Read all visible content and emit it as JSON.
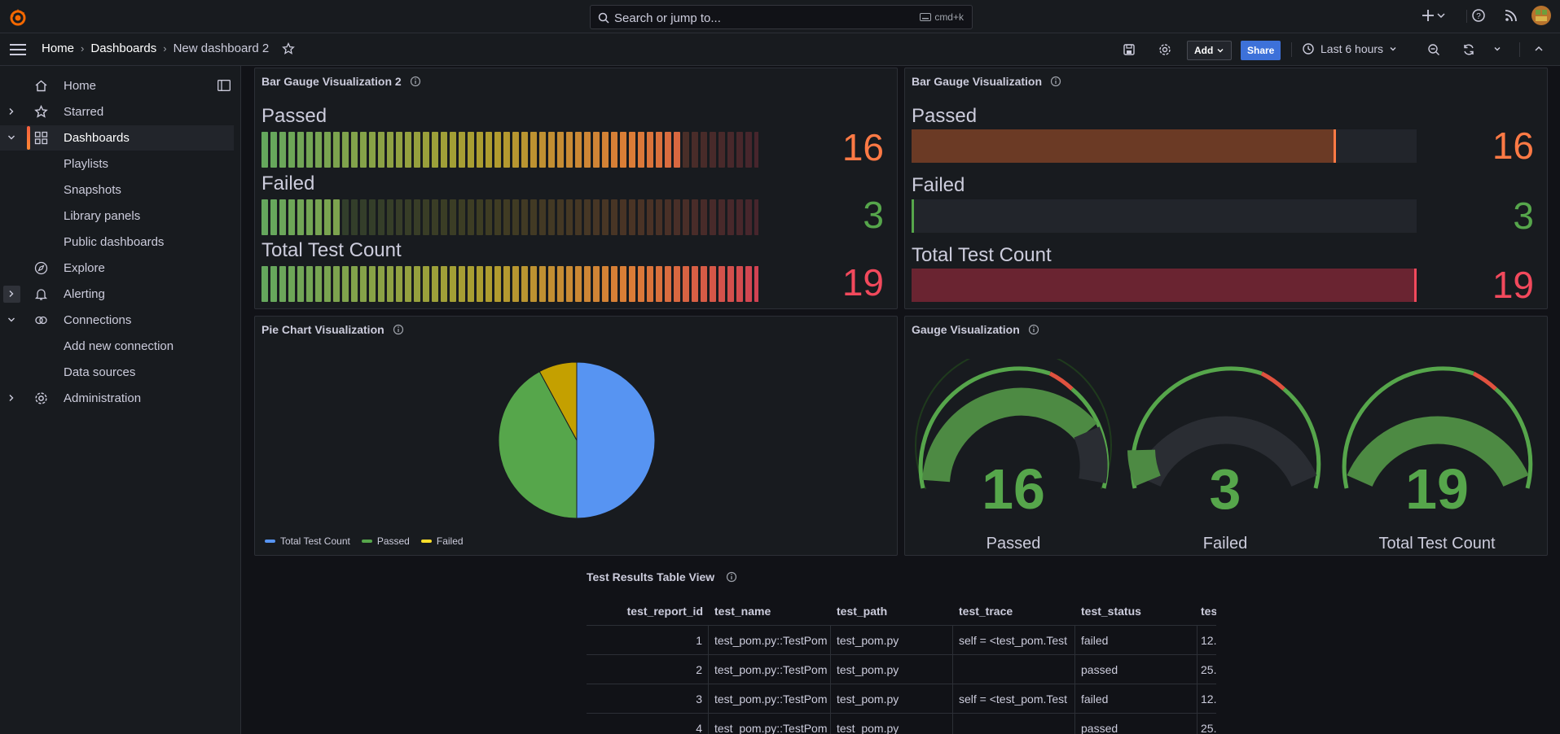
{
  "topbar": {
    "search_placeholder": "Search or jump to...",
    "shortcut": "cmd+k"
  },
  "breadcrumb": [
    "Home",
    "Dashboards",
    "New dashboard 2"
  ],
  "toolbar": {
    "add_label": "Add",
    "share_label": "Share",
    "time_range": "Last 6 hours"
  },
  "sidebar": {
    "items": [
      {
        "label": "Home"
      },
      {
        "label": "Starred"
      },
      {
        "label": "Dashboards"
      },
      {
        "label": "Playlists"
      },
      {
        "label": "Snapshots"
      },
      {
        "label": "Library panels"
      },
      {
        "label": "Public dashboards"
      },
      {
        "label": "Explore"
      },
      {
        "label": "Alerting"
      },
      {
        "label": "Connections"
      },
      {
        "label": "Add new connection"
      },
      {
        "label": "Data sources"
      },
      {
        "label": "Administration"
      }
    ]
  },
  "panels": {
    "bar_gauge_2": {
      "title": "Bar Gauge Visualization 2",
      "rows": [
        {
          "label": "Passed",
          "value": "16",
          "fraction": 0.84
        },
        {
          "label": "Failed",
          "value": "3",
          "fraction": 0.16
        },
        {
          "label": "Total Test Count",
          "value": "19",
          "fraction": 1.0
        }
      ]
    },
    "bar_gauge": {
      "title": "Bar Gauge Visualization",
      "rows": [
        {
          "label": "Passed",
          "value": "16",
          "fraction": 0.84
        },
        {
          "label": "Failed",
          "value": "3",
          "fraction": 0.0
        },
        {
          "label": "Total Test Count",
          "value": "19",
          "fraction": 1.0
        }
      ]
    },
    "pie": {
      "title": "Pie Chart Visualization",
      "legend": [
        "Total Test Count",
        "Passed",
        "Failed"
      ]
    },
    "gauge": {
      "title": "Gauge Visualization",
      "items": [
        {
          "label": "Passed",
          "value": "16"
        },
        {
          "label": "Failed",
          "value": "3"
        },
        {
          "label": "Total Test Count",
          "value": "19"
        }
      ]
    },
    "table": {
      "title": "Test Results Table View",
      "columns": [
        "test_report_id",
        "test_name",
        "test_path",
        "test_trace",
        "test_status",
        "tes"
      ],
      "rows": [
        [
          "1",
          "test_pom.py::TestPom",
          "test_pom.py",
          "self = <test_pom.Test",
          "failed",
          "12."
        ],
        [
          "2",
          "test_pom.py::TestPom",
          "test_pom.py",
          "",
          "passed",
          "25."
        ],
        [
          "3",
          "test_pom.py::TestPom",
          "test_pom.py",
          "self = <test_pom.Test",
          "failed",
          "12."
        ],
        [
          "4",
          "test_pom.py::TestPom",
          "test_pom.py",
          "",
          "passed",
          "25."
        ]
      ]
    }
  },
  "colors": {
    "passed": "#73bf69",
    "failed": "#fade2a",
    "total": "#5794f2",
    "orange": "#ff7a45",
    "red": "#f2495c",
    "green": "#56a64b"
  },
  "chart_data": [
    {
      "type": "pie",
      "title": "Pie Chart Visualization",
      "categories": [
        "Total Test Count",
        "Passed",
        "Failed"
      ],
      "values": [
        19,
        16,
        3
      ],
      "colors": [
        "#5794f2",
        "#56a64b",
        "#c4a000"
      ],
      "legend": "bottom-left"
    }
  ]
}
